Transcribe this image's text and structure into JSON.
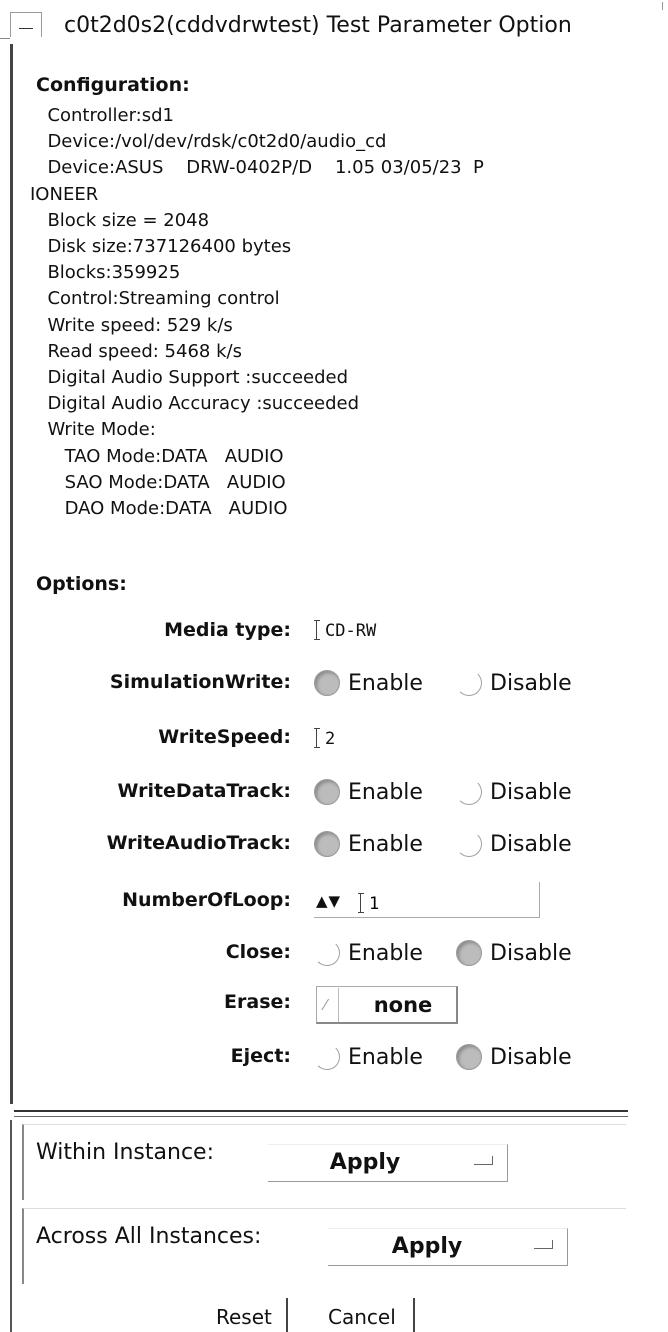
{
  "window": {
    "title": "c0t2d0s2(cddvdrwtest) Test Parameter Option"
  },
  "configuration": {
    "header": "Configuration:",
    "lines": [
      "  Controller:sd1",
      "  Device:/vol/dev/rdsk/c0t2d0/audio_cd",
      "  Device:ASUS    DRW-0402P/D    1.05 03/05/23  P",
      "IONEER",
      "  Block size = 2048",
      "  Disk size:737126400 bytes",
      "  Blocks:359925",
      "  Control:Streaming control",
      "  Write speed: 529 k/s",
      "  Read speed: 5468 k/s",
      "  Digital Audio Support :succeeded",
      "  Digital Audio Accuracy :succeeded",
      "  Write Mode:",
      "     TAO Mode:DATA   AUDIO",
      "     SAO Mode:DATA   AUDIO",
      "     DAO Mode:DATA   AUDIO"
    ]
  },
  "options": {
    "header": "Options:",
    "media_type": {
      "label": "Media type:",
      "value": "CD-RW"
    },
    "simulation_write": {
      "label": "SimulationWrite:",
      "enable": "Enable",
      "disable": "Disable",
      "selected": "Enable"
    },
    "write_speed": {
      "label": "WriteSpeed:",
      "value": "2"
    },
    "write_data_track": {
      "label": "WriteDataTrack:",
      "enable": "Enable",
      "disable": "Disable",
      "selected": "Enable"
    },
    "write_audio_track": {
      "label": "WriteAudioTrack:",
      "enable": "Enable",
      "disable": "Disable",
      "selected": "Enable"
    },
    "number_of_loop": {
      "label": "NumberOfLoop:",
      "value": "1",
      "arrows": "▲▼"
    },
    "close": {
      "label": "Close:",
      "enable": "Enable",
      "disable": "Disable",
      "selected": "Disable"
    },
    "erase": {
      "label": "Erase:",
      "value": "none"
    },
    "eject": {
      "label": "Eject:",
      "enable": "Enable",
      "disable": "Disable",
      "selected": "Disable"
    }
  },
  "within_instance": {
    "label": "Within Instance:",
    "button": "Apply"
  },
  "across_instances": {
    "label": "Across All Instances:",
    "button": "Apply"
  },
  "buttons": {
    "reset": "Reset",
    "cancel": "Cancel"
  }
}
